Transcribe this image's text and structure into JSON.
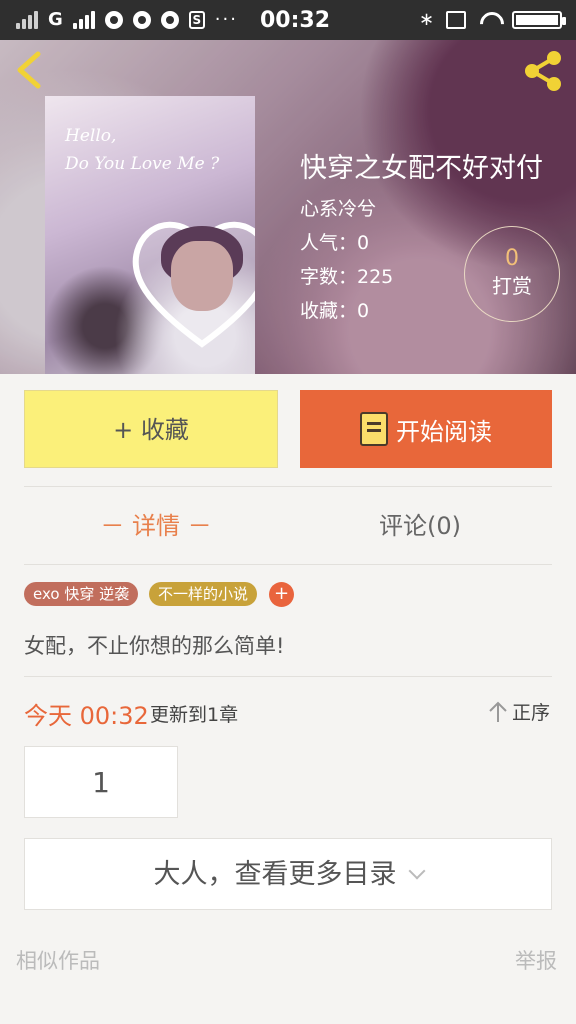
{
  "status_bar": {
    "carrier": "G",
    "time": "00:32",
    "more": "···",
    "s_icon": "S",
    "icons": [
      "signal-weak-icon",
      "signal-strong-icon",
      "notification-icon",
      "notification-icon",
      "notification-icon",
      "s-app-icon",
      "bluetooth-icon",
      "vibrate-icon",
      "wifi-icon",
      "battery-charging-icon"
    ]
  },
  "nav": {
    "back_icon": "chevron-left-icon",
    "share_icon": "share-icon"
  },
  "cover": {
    "line1": "Hello,",
    "line2": "Do You Love Me ?"
  },
  "book": {
    "title": "快穿之女配不好对付",
    "author": "心系冷兮",
    "popularity": "人气：0",
    "word_count": "字数：225",
    "favorites": "收藏：0"
  },
  "reward": {
    "count": "0",
    "label": "打赏"
  },
  "actions": {
    "collect": "+ 收藏",
    "read": "开始阅读"
  },
  "tabs": {
    "detail": "－ 详情 －",
    "comments": "评论(0)"
  },
  "tags": [
    {
      "label": "exo 快穿 逆袭",
      "color": "#c16e5d"
    },
    {
      "label": "不一样的小说",
      "color": "#c8a23a"
    }
  ],
  "tag_add": "+",
  "description": "女配，不止你想的那么简单!",
  "update": {
    "time": "今天 00:32",
    "text": "更新到1章",
    "sort": "正序"
  },
  "chapter": {
    "number": "1"
  },
  "more_catalog": "大人，查看更多目录",
  "footer": {
    "similar": "相似作品",
    "report": "举报"
  },
  "colors": {
    "accent": "#e8673a",
    "collect_bg": "#fbf07a",
    "tab_active": "#e8804c"
  }
}
